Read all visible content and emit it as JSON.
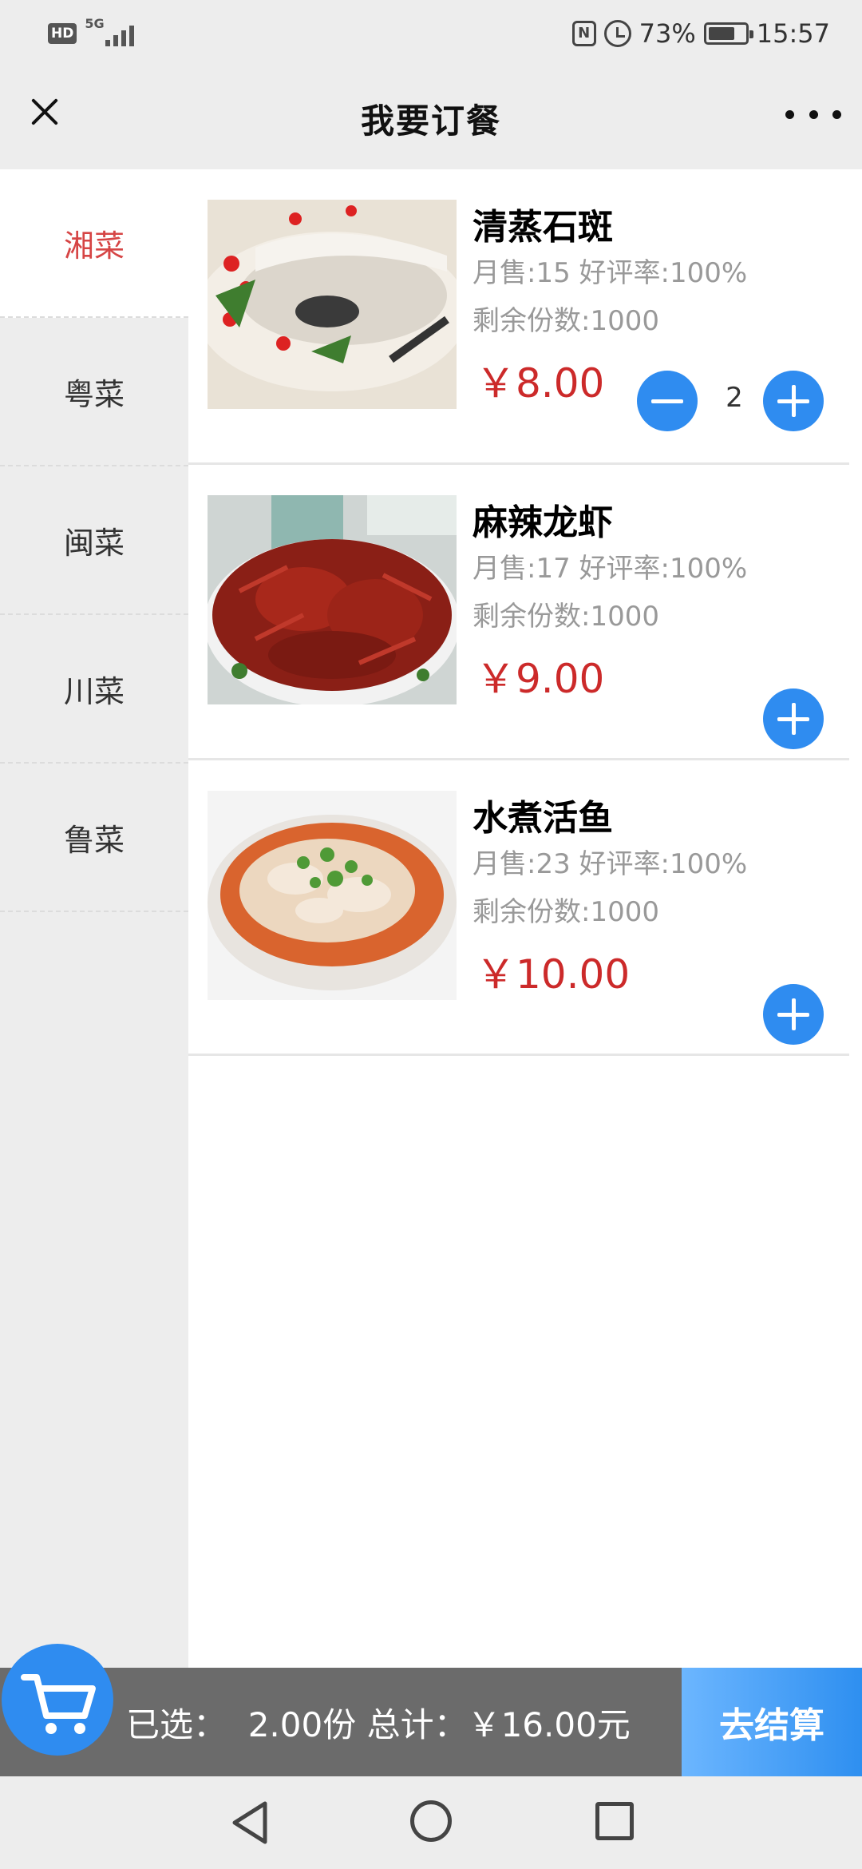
{
  "status_bar": {
    "hd": "HD",
    "network": "5G",
    "battery_percent": "73%",
    "time": "15:57",
    "nfc": "N",
    "battery_level": 0.73
  },
  "header": {
    "title": "我要订餐"
  },
  "sidebar": {
    "items": [
      {
        "label": "湘菜"
      },
      {
        "label": "粤菜"
      },
      {
        "label": "闽菜"
      },
      {
        "label": "川菜"
      },
      {
        "label": "鲁菜"
      }
    ]
  },
  "dishes": [
    {
      "name": "清蒸石斑",
      "sales": "月售:15 好评率:100%",
      "remaining": "剩余份数:1000",
      "price": "￥8.00",
      "quantity": "2"
    },
    {
      "name": "麻辣龙虾",
      "sales": "月售:17 好评率:100%",
      "remaining": "剩余份数:1000",
      "price": "￥9.00"
    },
    {
      "name": "水煮活鱼",
      "sales": "月售:23 好评率:100%",
      "remaining": "剩余份数:1000",
      "price": "￥10.00"
    }
  ],
  "cart": {
    "summary": "已选：  2.00份 总计：￥16.00元",
    "checkout_label": "去结算"
  },
  "colors": {
    "accent_blue": "#2f8cf0",
    "price_red": "#cc2a2a",
    "active_category": "#d64545"
  }
}
